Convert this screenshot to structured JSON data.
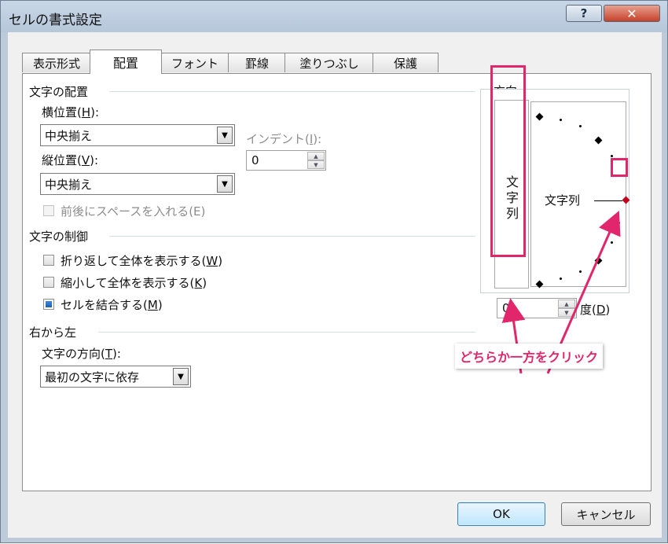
{
  "window": {
    "title": "セルの書式設定",
    "help_label": "?",
    "close_label": "✕"
  },
  "tabs": [
    {
      "label": "表示形式",
      "active": false
    },
    {
      "label": "配置",
      "active": true
    },
    {
      "label": "フォント",
      "active": false
    },
    {
      "label": "罫線",
      "active": false
    },
    {
      "label": "塗りつぶし",
      "active": false
    },
    {
      "label": "保護",
      "active": false
    }
  ],
  "alignment": {
    "group_title": "文字の配置",
    "horizontal": {
      "label": "横位置(",
      "key": "H",
      "label_end": "):",
      "value": "中央揃え"
    },
    "indent": {
      "label": "インデント(",
      "key": "I",
      "label_end": "):",
      "value": "0"
    },
    "vertical": {
      "label": "縦位置(",
      "key": "V",
      "label_end": "):",
      "value": "中央揃え"
    },
    "distributed": {
      "label": "前後にスペースを入れる(E)",
      "checked": false,
      "enabled": false
    }
  },
  "text_control": {
    "group_title": "文字の制御",
    "wrap": {
      "label": "折り返して全体を表示する(",
      "key": "W",
      "label_end": ")",
      "checked": false
    },
    "shrink": {
      "label": "縮小して全体を表示する(",
      "key": "K",
      "label_end": ")",
      "checked": false
    },
    "merge": {
      "label": "セルを結合する(",
      "key": "M",
      "label_end": ")",
      "checked": true
    }
  },
  "rtl": {
    "group_title": "右から左",
    "direction": {
      "label": "文字の方向(",
      "key": "T",
      "label_end": "):",
      "value": "最初の文字に依存"
    }
  },
  "orientation": {
    "group_title": "方向",
    "vertical_text": [
      "文",
      "字",
      "列"
    ],
    "dial_text": "文字列",
    "degree_value": "0",
    "degree_label": "度(",
    "degree_key": "D",
    "degree_label_end": ")"
  },
  "annotation": {
    "callout_text": "どちらか一方をクリック",
    "color": "#e2266b"
  },
  "buttons": {
    "ok": "OK",
    "cancel": "キャンセル"
  }
}
